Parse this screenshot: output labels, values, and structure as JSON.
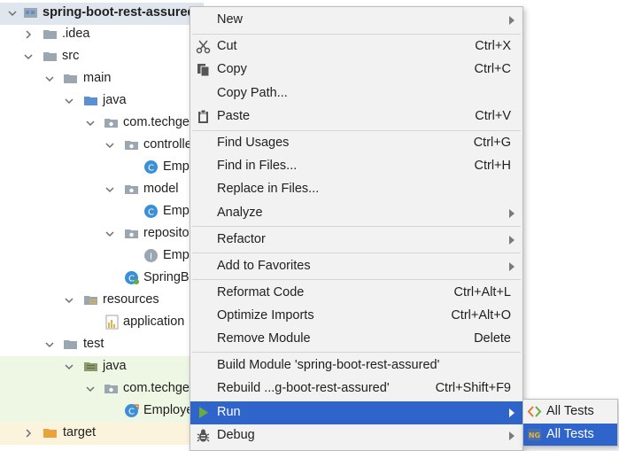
{
  "tree": {
    "items": [
      {
        "label": "spring-boot-rest-assured",
        "icon": "module-folder-icon",
        "expanded": true
      },
      {
        "label": ".idea",
        "icon": "folder-icon",
        "expanded": false
      },
      {
        "label": "src",
        "icon": "folder-icon",
        "expanded": true
      },
      {
        "label": "main",
        "icon": "folder-icon",
        "expanded": true
      },
      {
        "label": "java",
        "icon": "source-folder-icon",
        "expanded": true
      },
      {
        "label": "com.techge",
        "icon": "package-icon",
        "expanded": true
      },
      {
        "label": "controlle",
        "icon": "package-icon",
        "expanded": true
      },
      {
        "label": "Emp",
        "icon": "class-icon"
      },
      {
        "label": "model",
        "icon": "package-icon",
        "expanded": true
      },
      {
        "label": "Emp",
        "icon": "class-icon"
      },
      {
        "label": "reposito",
        "icon": "package-icon",
        "expanded": true
      },
      {
        "label": "Emp",
        "icon": "interface-icon"
      },
      {
        "label": "SpringB",
        "icon": "spring-class-icon"
      },
      {
        "label": "resources",
        "icon": "resources-folder-icon",
        "expanded": true
      },
      {
        "label": "application",
        "icon": "properties-file-icon"
      },
      {
        "label": "test",
        "icon": "folder-icon",
        "expanded": true
      },
      {
        "label": "java",
        "icon": "test-source-folder-icon",
        "expanded": true
      },
      {
        "label": "com.techge",
        "icon": "package-icon",
        "expanded": true
      },
      {
        "label": "Employe",
        "icon": "test-class-icon"
      },
      {
        "label": "target",
        "icon": "excluded-folder-icon",
        "expanded": false
      }
    ]
  },
  "menu": {
    "items": [
      {
        "label": "New",
        "shortcut": "",
        "submenu": true,
        "icon": ""
      },
      {
        "label": "Cut",
        "shortcut": "Ctrl+X",
        "icon": "scissors-icon"
      },
      {
        "label": "Copy",
        "shortcut": "Ctrl+C",
        "icon": "copy-icon"
      },
      {
        "label": "Copy Path...",
        "shortcut": "",
        "icon": ""
      },
      {
        "label": "Paste",
        "shortcut": "Ctrl+V",
        "icon": "clipboard-icon"
      },
      {
        "label": "Find Usages",
        "shortcut": "Ctrl+G",
        "icon": ""
      },
      {
        "label": "Find in Files...",
        "shortcut": "Ctrl+H",
        "icon": ""
      },
      {
        "label": "Replace in Files...",
        "shortcut": "",
        "icon": ""
      },
      {
        "label": "Analyze",
        "shortcut": "",
        "submenu": true,
        "icon": ""
      },
      {
        "label": "Refactor",
        "shortcut": "",
        "submenu": true,
        "icon": ""
      },
      {
        "label": "Add to Favorites",
        "shortcut": "",
        "submenu": true,
        "icon": ""
      },
      {
        "label": "Reformat Code",
        "shortcut": "Ctrl+Alt+L",
        "icon": ""
      },
      {
        "label": "Optimize Imports",
        "shortcut": "Ctrl+Alt+O",
        "icon": ""
      },
      {
        "label": "Remove Module",
        "shortcut": "Delete",
        "icon": ""
      },
      {
        "label": "Build Module 'spring-boot-rest-assured'",
        "shortcut": "",
        "icon": ""
      },
      {
        "label": "Rebuild ...g-boot-rest-assured'",
        "shortcut": "Ctrl+Shift+F9",
        "icon": ""
      },
      {
        "label": "Run",
        "shortcut": "",
        "submenu": true,
        "icon": "run-icon",
        "selected": true
      },
      {
        "label": "Debug",
        "shortcut": "",
        "submenu": true,
        "icon": "debug-icon"
      }
    ]
  },
  "submenu": {
    "items": [
      {
        "label": "All Tests",
        "icon": "junit-icon"
      },
      {
        "label": "All Tests",
        "icon": "testng-icon",
        "selected": true
      }
    ]
  },
  "colors": {
    "selection": "#2f65ca",
    "menu_bg": "#f2f2f2",
    "tree_root_highlight": "#dfe6ee",
    "tree_test_highlight": "#eef6e4",
    "tree_target_highlight": "#fbf3dc"
  }
}
